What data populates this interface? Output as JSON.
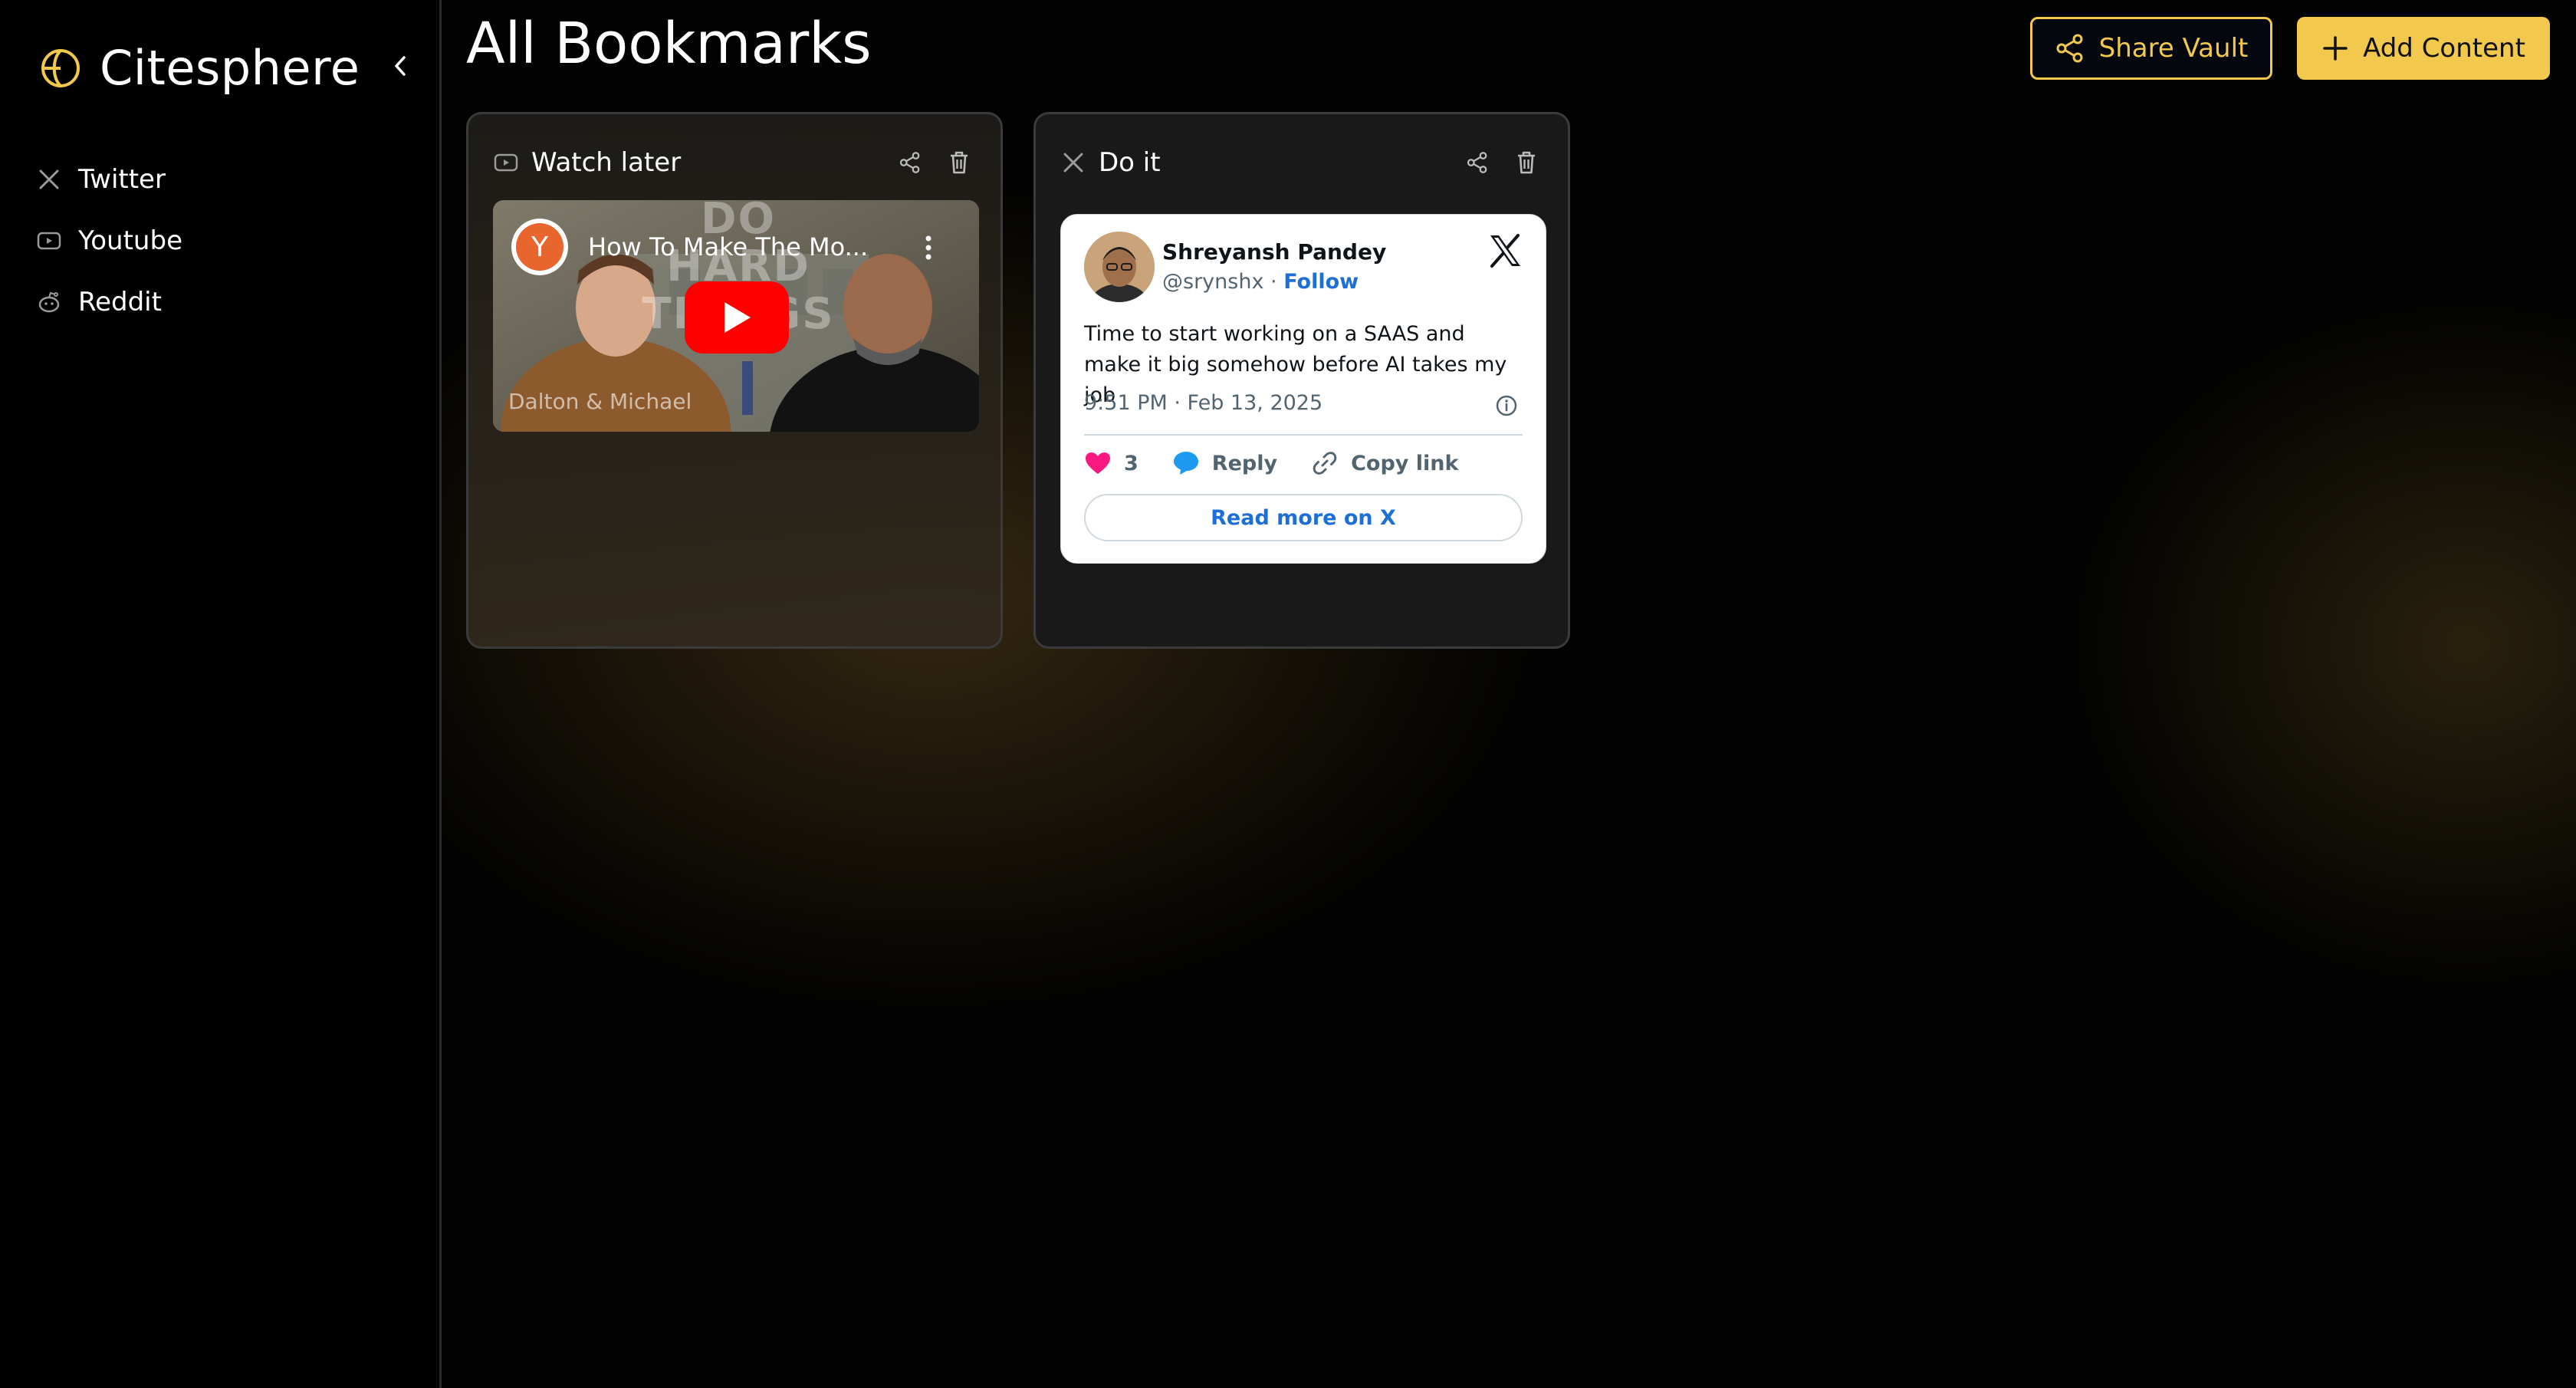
{
  "brand": {
    "name": "Citesphere"
  },
  "sidebar": {
    "items": [
      {
        "label": "Twitter",
        "icon": "x-icon"
      },
      {
        "label": "Youtube",
        "icon": "youtube-icon"
      },
      {
        "label": "Reddit",
        "icon": "reddit-icon"
      }
    ]
  },
  "header": {
    "title": "All Bookmarks",
    "share_label": "Share Vault",
    "add_label": "Add Content"
  },
  "colors": {
    "accent": "#f2c94c",
    "like": "#f91880",
    "link": "#1d6fd8"
  },
  "cards": [
    {
      "title": "Watch later",
      "type": "youtube",
      "video": {
        "title": "How To Make The Mo...",
        "channel_initial": "Y",
        "thumbnail_heading": "DO HARD THINGS",
        "caption": "Dalton & Michael"
      }
    },
    {
      "title": "Do it",
      "type": "twitter",
      "tweet": {
        "author": "Shreyansh Pandey",
        "handle": "@srynshx",
        "separator": "·",
        "follow_label": "Follow",
        "text": "Time to start working on a SAAS and make it big somehow before AI takes my job",
        "timestamp": "9:51 PM · Feb 13, 2025",
        "likes": "3",
        "reply_label": "Reply",
        "copy_label": "Copy link",
        "read_more_label": "Read more on X"
      }
    }
  ]
}
